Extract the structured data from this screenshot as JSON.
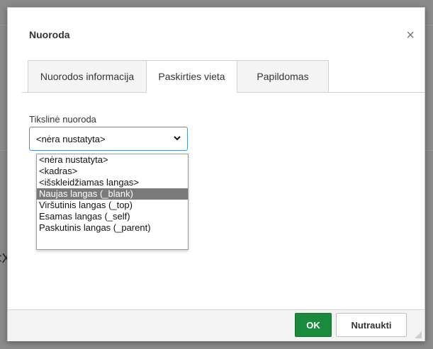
{
  "dialog": {
    "title": "Nuoroda",
    "close_glyph": "×",
    "tabs": [
      {
        "label": "Nuorodos informacija",
        "active": false
      },
      {
        "label": "Paskirties vieta",
        "active": true
      },
      {
        "label": "Papildomas",
        "active": false
      }
    ],
    "target_field": {
      "label": "Tikslinė nuoroda",
      "value": "<nėra nustatyta>",
      "options": [
        {
          "label": "<nėra nustatyta>",
          "selected": false
        },
        {
          "label": "<kadras>",
          "selected": false
        },
        {
          "label": "<išskleidžiamas langas>",
          "selected": false
        },
        {
          "label": "Naujas langas (_blank)",
          "selected": true
        },
        {
          "label": "Viršutinis langas (_top)",
          "selected": false
        },
        {
          "label": "Esamas langas (_self)",
          "selected": false
        },
        {
          "label": "Paskutinis langas (_parent)",
          "selected": false
        }
      ]
    },
    "buttons": {
      "ok": "OK",
      "cancel": "Nutraukti"
    }
  },
  "background": {
    "partial_text": "<X"
  },
  "colors": {
    "ok_button": "#1a8b3c",
    "selected_option": "#7a7a7a",
    "focus_border": "#4a90d9"
  }
}
